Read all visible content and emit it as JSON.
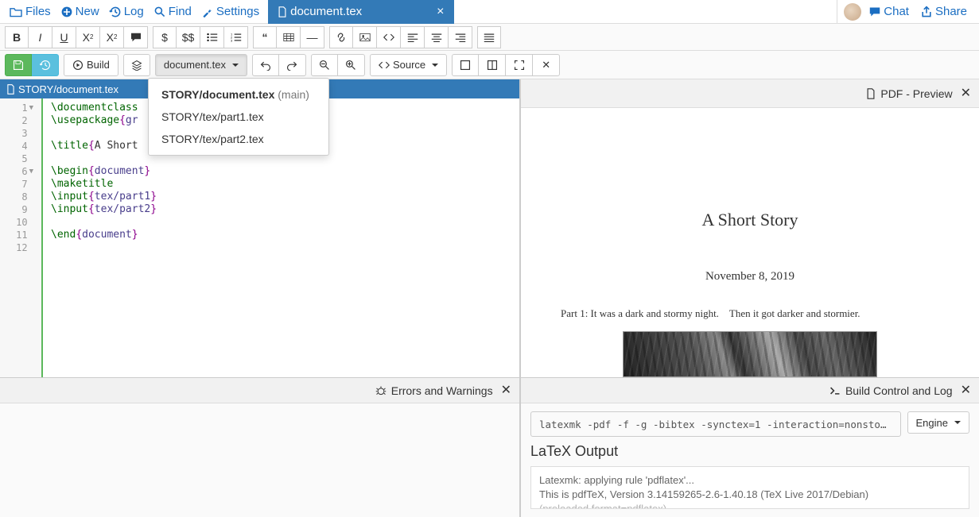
{
  "topnav": {
    "files": "Files",
    "new": "New",
    "log": "Log",
    "find": "Find",
    "settings": "Settings",
    "tab_label": "document.tex",
    "chat": "Chat",
    "share": "Share"
  },
  "buildbar": {
    "build": "Build",
    "file_select": "document.tex",
    "source": "Source"
  },
  "dropdown": {
    "items": [
      {
        "label": "STORY/document.tex",
        "suffix": "(main)"
      },
      {
        "label": "STORY/tex/part1.tex",
        "suffix": ""
      },
      {
        "label": "STORY/tex/part2.tex",
        "suffix": ""
      }
    ]
  },
  "editor": {
    "path": "STORY/document.tex",
    "lines": [
      "1",
      "2",
      "3",
      "4",
      "5",
      "6",
      "7",
      "8",
      "9",
      "10",
      "11",
      "12"
    ]
  },
  "errors": {
    "title": "Errors and Warnings"
  },
  "pdf": {
    "header": "PDF - Preview",
    "title": "A Short Story",
    "date": "November 8, 2019",
    "para": "Part 1: It was a dark and stormy night. Then it got darker and stormier."
  },
  "log": {
    "title": "Build Control and Log",
    "cmd": "latexmk -pdf -f -g -bibtex -synctex=1 -interaction=nonsto…",
    "engine": "Engine",
    "heading": "LaTeX Output",
    "out1": "Latexmk: applying rule 'pdflatex'...",
    "out2": "This is pdfTeX, Version 3.14159265-2.6-1.40.18 (TeX Live 2017/Debian)",
    "out3": "(preloaded format=pdflatex)"
  }
}
